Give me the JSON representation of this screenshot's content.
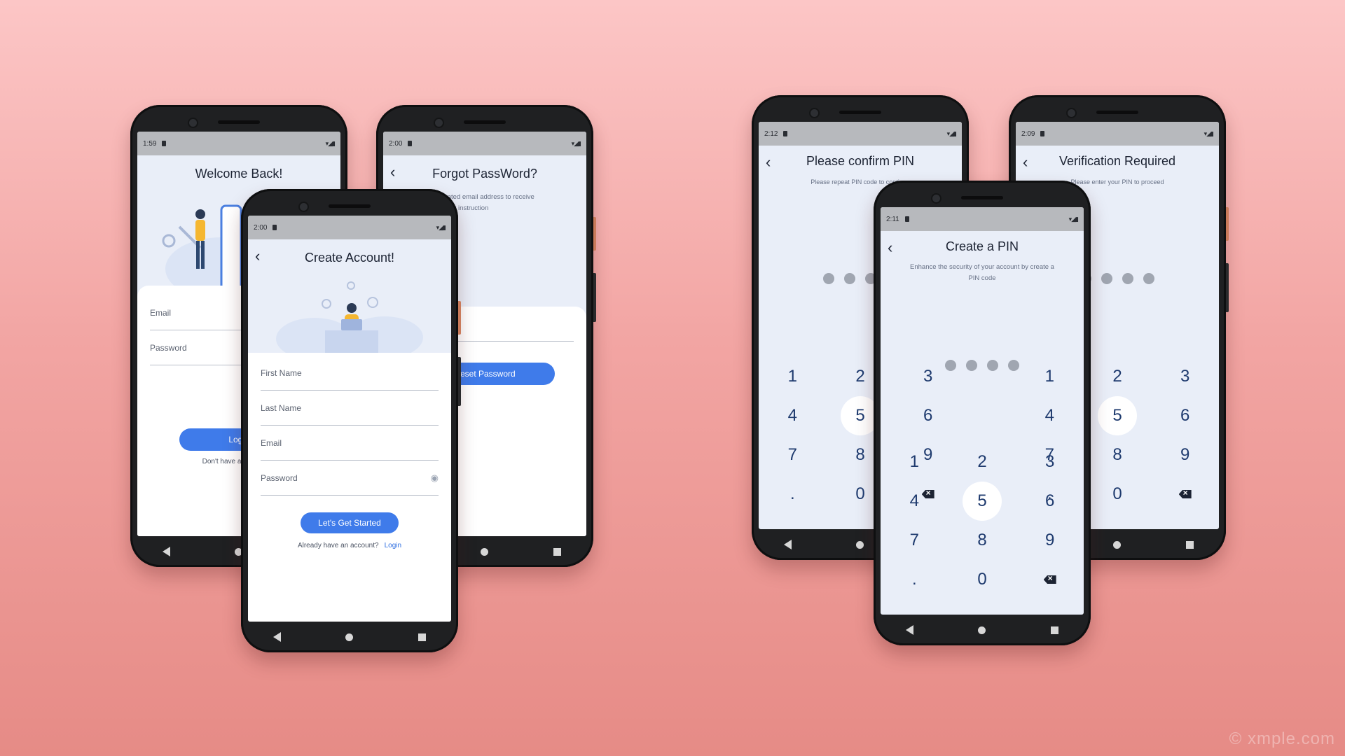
{
  "watermark": "© xmple.com",
  "login": {
    "time": "1:59",
    "title": "Welcome Back!",
    "email_label": "Email",
    "password_label": "Password",
    "login_button": "Login",
    "signup_prompt": "Don't have an account?"
  },
  "forgot": {
    "time": "2:00",
    "title": "Forgot PassWord?",
    "description": "Enter registrated email address to receive password reset instruction",
    "reset_button": "Reset Password"
  },
  "create_account": {
    "time": "2:00",
    "title": "Create Account!",
    "first_name_label": "First Name",
    "last_name_label": "Last Name",
    "email_label": "Email",
    "password_label": "Password",
    "submit_button": "Let's Get Started",
    "login_prompt": "Already have an account?",
    "login_link": "Login"
  },
  "confirm_pin": {
    "time": "2:12",
    "title": "Please confirm PIN",
    "subtitle": "Please repeat PIN code to continue"
  },
  "verify": {
    "time": "2:09",
    "title": "Verification Required",
    "subtitle": "Please enter your PIN to proceed"
  },
  "create_pin": {
    "time": "2:11",
    "title": "Create a PIN",
    "subtitle": "Enhance the security of your account by create a PIN code",
    "highlighted_key": "5"
  },
  "keypad_keys": [
    "1",
    "2",
    "3",
    "4",
    "5",
    "6",
    "7",
    "8",
    "9",
    ".",
    "0",
    "backspace"
  ],
  "colors": {
    "accent": "#3f7bea",
    "screen_bg": "#e9eef8",
    "key_text": "#1e3a6e"
  }
}
